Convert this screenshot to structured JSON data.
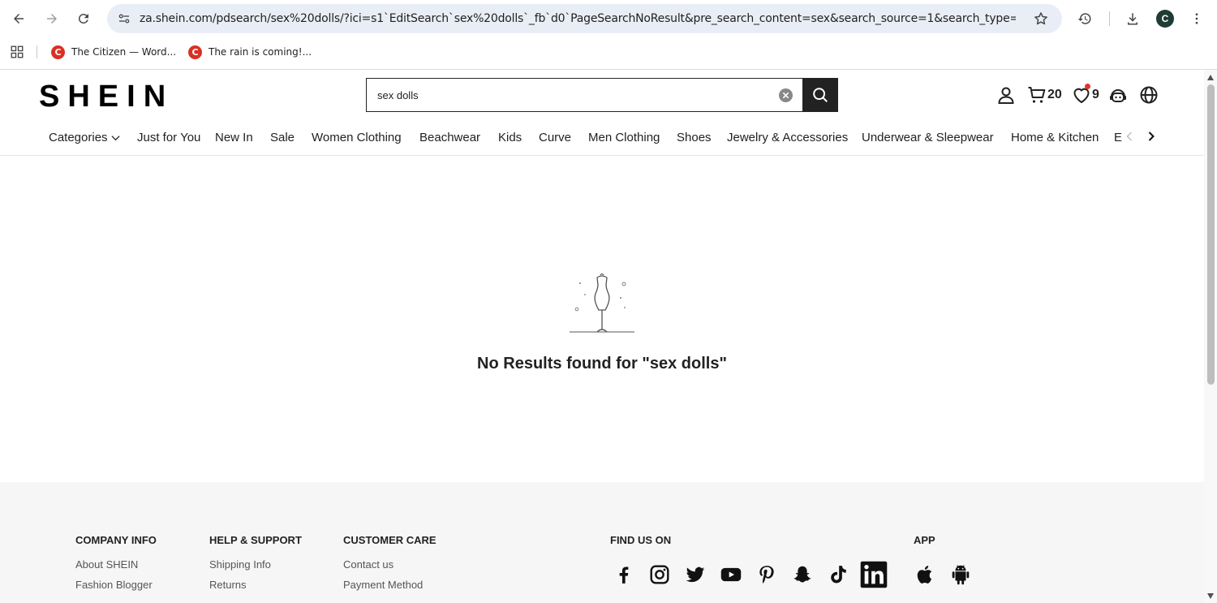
{
  "browser": {
    "url": "za.shein.com/pdsearch/sex%20dolls/?ici=s1`EditSearch`sex%20dolls`_fb`d0`PageSearchNoResult&pre_search_content=sex&search_source=1&search_type=all...",
    "profile_initial": "C",
    "bookmarks": [
      {
        "label": "The Citizen — Word...",
        "favicon": "C"
      },
      {
        "label": "The rain is coming!...",
        "favicon": "C"
      }
    ]
  },
  "header": {
    "logo": "SHEIN",
    "search_value": "sex dolls",
    "cart_count": "20",
    "wishlist_count": "9"
  },
  "nav": {
    "items": [
      "Categories",
      "Just for You",
      "New In",
      "Sale",
      "Women Clothing",
      "Beachwear",
      "Kids",
      "Curve",
      "Men Clothing",
      "Shoes",
      "Jewelry & Accessories",
      "Underwear & Sleepwear",
      "Home & Kitchen",
      "E"
    ]
  },
  "main": {
    "no_results_text": "No Results found for \"sex dolls\""
  },
  "footer": {
    "company_info": {
      "title": "COMPANY INFO",
      "links": [
        "About SHEIN",
        "Fashion Blogger"
      ]
    },
    "help_support": {
      "title": "HELP & SUPPORT",
      "links": [
        "Shipping Info",
        "Returns"
      ]
    },
    "customer_care": {
      "title": "CUSTOMER CARE",
      "links": [
        "Contact us",
        "Payment Method"
      ]
    },
    "find_us_on": {
      "title": "FIND US ON",
      "icons": [
        "facebook-icon",
        "instagram-icon",
        "twitter-icon",
        "youtube-icon",
        "pinterest-icon",
        "snapchat-icon",
        "tiktok-icon",
        "linkedin-icon"
      ]
    },
    "app": {
      "title": "APP",
      "icons": [
        "apple-icon",
        "android-icon"
      ]
    }
  }
}
